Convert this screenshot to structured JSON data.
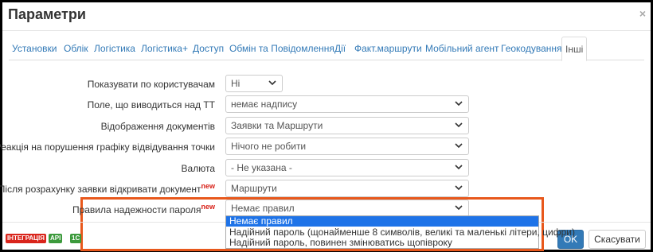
{
  "dialog": {
    "title": "Параметри",
    "close_label": "×"
  },
  "tabs": [
    {
      "label": "Установки"
    },
    {
      "label": "Облік"
    },
    {
      "label": "Логістика"
    },
    {
      "label": "Логістика+"
    },
    {
      "label": "Доступ"
    },
    {
      "label": "Обмін та Повідомлення"
    },
    {
      "label": "Дії"
    },
    {
      "label": "Факт.маршрути"
    },
    {
      "label": "Мобільний агент"
    },
    {
      "label": "Геокодування"
    },
    {
      "label": "Інші",
      "active": true
    }
  ],
  "form": {
    "rows": [
      {
        "label": "Показувати по користувачам",
        "value": "Ні"
      },
      {
        "label": "Поле, що виводиться над ТТ",
        "value": "немає надпису"
      },
      {
        "label": "Відображення документів",
        "value": "Заявки та Маршрути"
      },
      {
        "label": "Реакція на порушення графіку відвідування точки",
        "value": "Нічого не робити"
      },
      {
        "label": "Валюта",
        "value": "- Не указана -"
      },
      {
        "label": "Після розрахунку заявки відкривати документ",
        "badge": "new",
        "value": "Маршрути"
      },
      {
        "label": "Правила надежности пароля",
        "badge": "new",
        "value": "Немає правил"
      }
    ]
  },
  "password_dropdown": {
    "options": [
      {
        "label": "Немає правил",
        "selected": true
      },
      {
        "label": "Надійний пароль (щонайменше 8 символів, великі та маленькі літери, цифри)"
      },
      {
        "label": "Надійний пароль, повинен змінюватись щопівроку"
      }
    ]
  },
  "footer": {
    "badges": [
      {
        "label": "ІНТЕГРАЦІЯ",
        "color": "#d9241b"
      },
      {
        "label": "API",
        "color": "#3c9a3c"
      },
      {
        "label": "1С",
        "color": "#3c9a3c"
      }
    ],
    "ok_label": "OK",
    "cancel_label": "Скасувати"
  },
  "colors": {
    "link": "#337ab7",
    "highlight": "#e8581c",
    "selected_option": "#1e73e8",
    "new_badge": "#d9241b"
  }
}
